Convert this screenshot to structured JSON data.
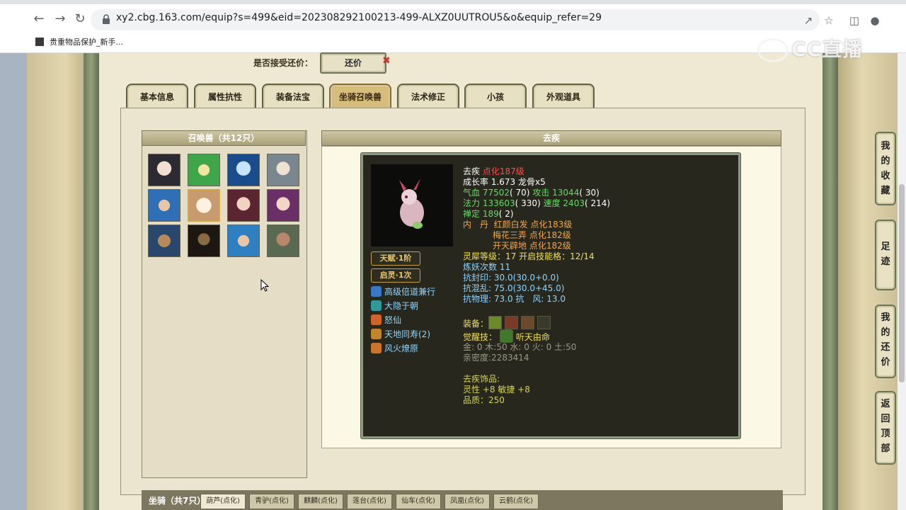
{
  "browser": {
    "url": "xy2.cbg.163.com/equip?s=499&eid=202308292100213-499-ALXZ0UUTROU5&o&equip_refer=29",
    "bookmark": "贵重物品保护_新手...",
    "watermark": "CC直播"
  },
  "bargain": {
    "label": "是否接受还价：",
    "button": "还价"
  },
  "tabs": [
    "基本信息",
    "属性抗性",
    "装备法宝",
    "坐骑召唤兽",
    "法术修正",
    "小孩",
    "外观道具"
  ],
  "active_tab": "坐骑召唤兽",
  "summon_panel": {
    "title": "召唤兽（共12只）"
  },
  "detail": {
    "title": "去疾",
    "name": "去疾",
    "transform": "点化187级",
    "growth": "成长率 1.673 龙骨x5",
    "hp_label": "气血",
    "hp": "77502",
    "hp_bonus": "( 70)",
    "atk_label": "攻击",
    "atk": "13044",
    "atk_bonus": "( 30)",
    "mp_label": "法力",
    "mp": "133603",
    "mp_bonus": "( 330)",
    "spd_label": "速度",
    "spd": "2403",
    "spd_bonus": "( 214)",
    "zen_label": "禅定",
    "zen": "189",
    "zen_bonus": "( 2)",
    "inner_label": "内　丹",
    "inner1": "红颜白发 点化183级",
    "inner2": "梅花三弄 点化182级",
    "inner3": "开天辟地 点化182级",
    "spirit": "灵犀等级：17 开启技能格：12/14",
    "refine": "炼妖次数 11",
    "res_seal": "抗封印: 30.0(30.0+0.0)",
    "res_chaos": "抗混乱: 75.0(30.0+45.0)",
    "res_phys": "抗物理: 73.0 抗　风: 13.0",
    "equip_label": "装备：",
    "awaken_label": "觉醒技：",
    "awaken_skill": "听天由命",
    "elements": "金: 0 木:50 水: 0 火: 0 土:50",
    "intimacy": "亲密度:2283414",
    "ornament_title": "去疾饰品:",
    "ornament_stats": "灵性 +8 敏捷 +8",
    "quality": "品质：250",
    "talent": "天赋·1阶",
    "awakening": "启灵·1次",
    "skills": [
      "高级倍道兼行",
      "大隐于朝",
      "怒仙",
      "天地同寿(2)",
      "风火燎原"
    ]
  },
  "mount": {
    "title": "坐骑（共7只）",
    "tabs": [
      "葫芦(点化)",
      "青驴(点化)",
      "麒麟(点化)",
      "莲台(点化)",
      "仙车(点化)",
      "凤凰(点化)",
      "云鹤(点化)"
    ]
  },
  "float_buttons": [
    [
      "我",
      "的",
      "收",
      "藏"
    ],
    [
      "足",
      "迹"
    ],
    [
      "我",
      "的",
      "还",
      "价"
    ],
    [
      "返",
      "回",
      "顶",
      "部"
    ]
  ],
  "colors": {
    "accent_gold": "#d2a64a",
    "tab_active": "#d7bd7d",
    "dark_panel": "#27271d"
  },
  "icons": [
    "back-icon",
    "forward-icon",
    "reload-icon",
    "lock-icon",
    "share-icon",
    "star-icon",
    "sidepanel-icon",
    "profile-icon"
  ]
}
